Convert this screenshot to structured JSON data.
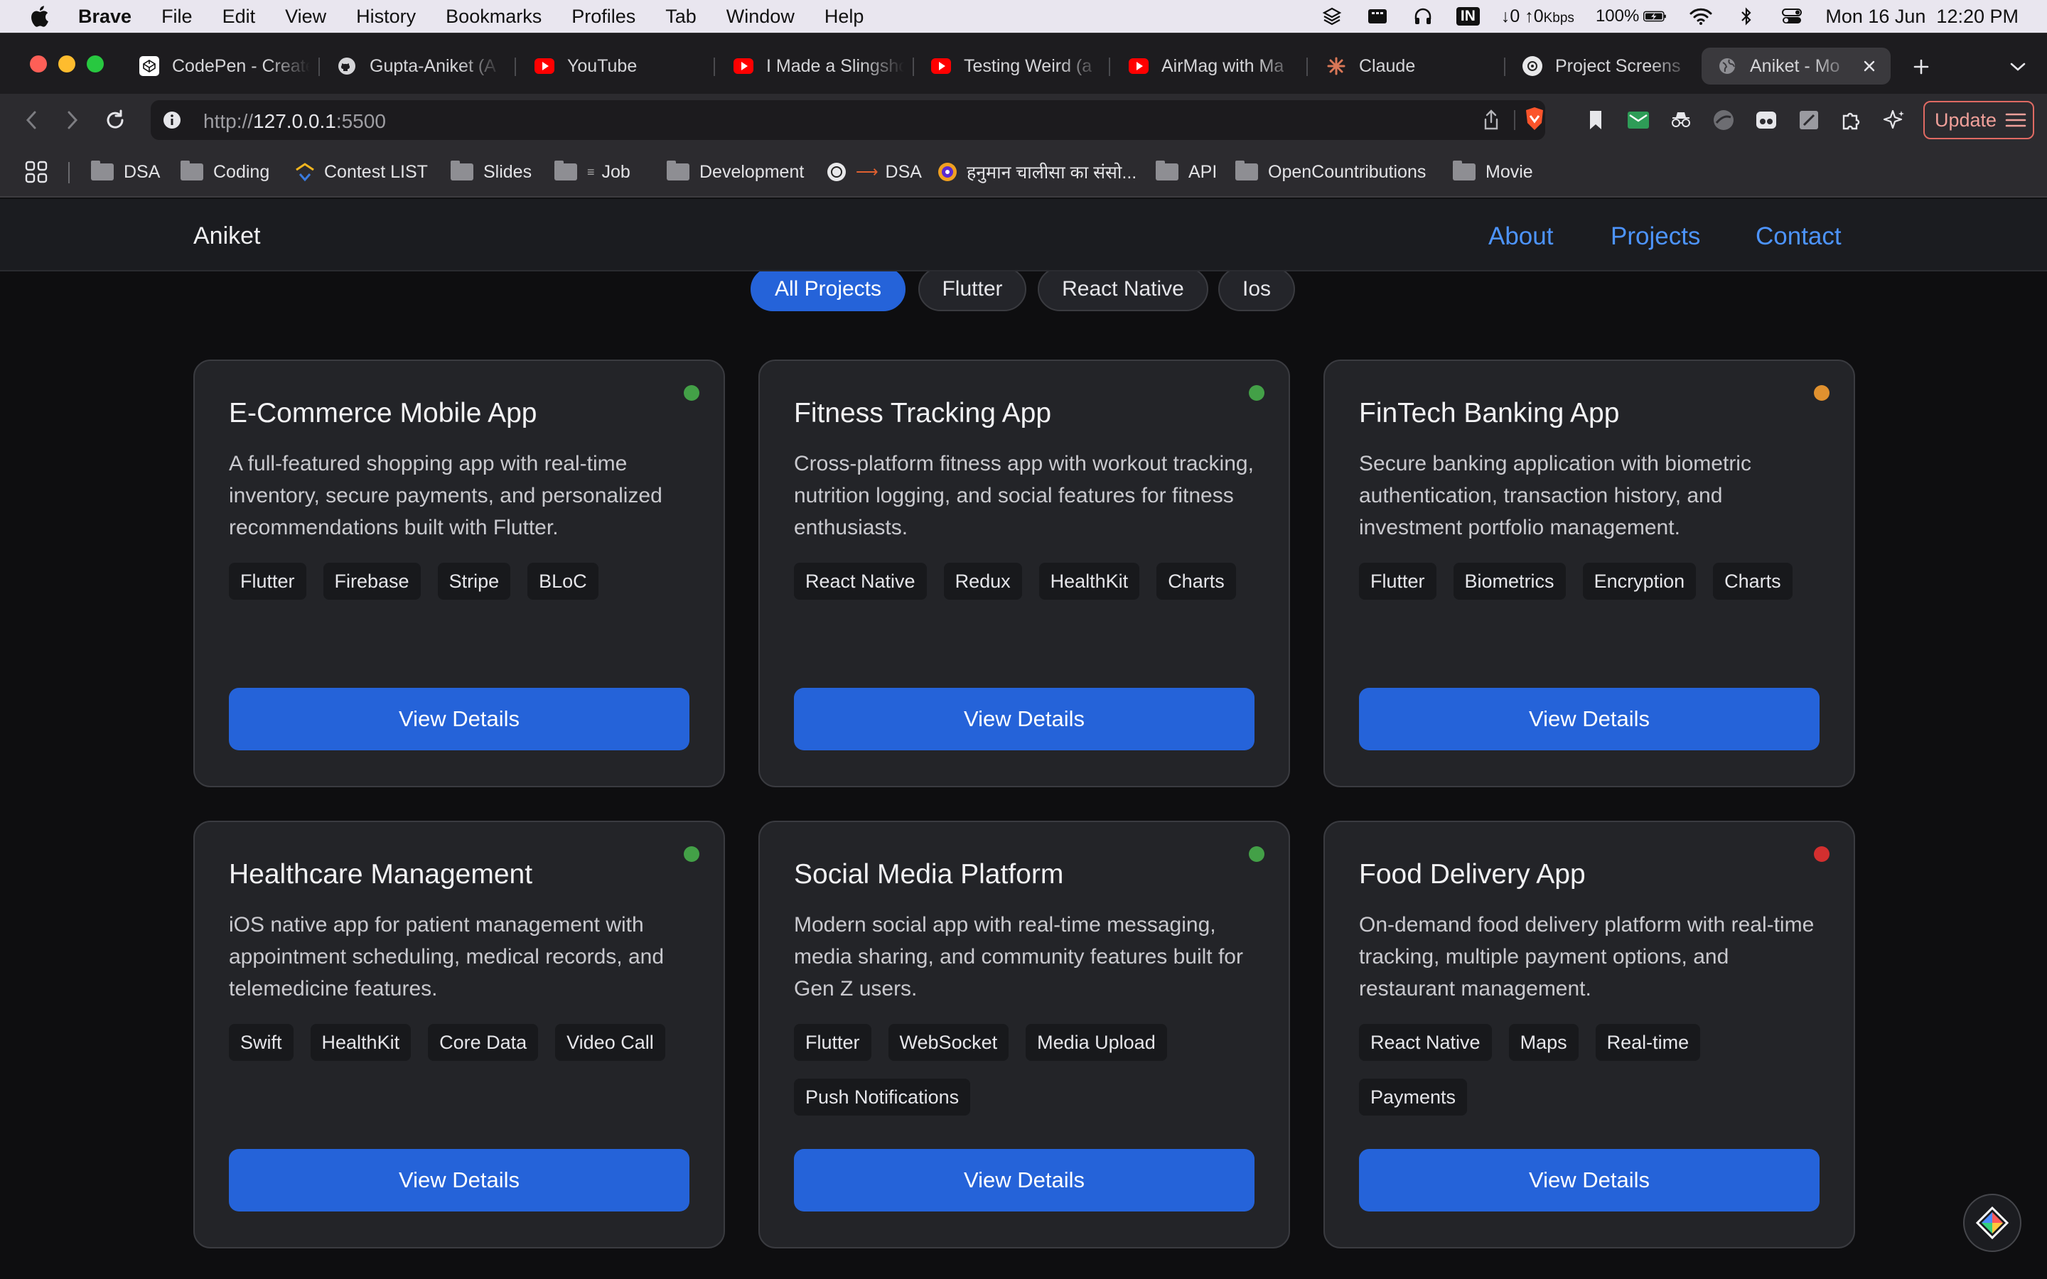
{
  "menubar": {
    "items": [
      "Brave",
      "File",
      "Edit",
      "View",
      "History",
      "Bookmarks",
      "Profiles",
      "Tab",
      "Window",
      "Help"
    ],
    "network": {
      "down": "↓0",
      "up": "↑0",
      "unit": "Kbps"
    },
    "input_source": "IN",
    "battery": "100%",
    "datetime": "Mon 16 Jun  12:20 PM"
  },
  "tabs": [
    {
      "label": "CodePen - Create"
    },
    {
      "label": "Gupta-Aniket (A"
    },
    {
      "label": "YouTube"
    },
    {
      "label": "I Made a Slingshot"
    },
    {
      "label": "Testing Weird (a"
    },
    {
      "label": "AirMag with Ma"
    },
    {
      "label": "Claude"
    },
    {
      "label": "Project Screens"
    },
    {
      "label": "Aniket - Mo"
    }
  ],
  "address": {
    "scheme": "http://",
    "host": "127.0.0.1",
    "port": ":5500"
  },
  "update_label": "Update",
  "bookmarks": [
    "DSA",
    "Coding",
    "Contest LIST",
    "Slides",
    "Job",
    "Development",
    "DSA",
    "हनुमान चालीसा का संसो...",
    "API",
    "OpenCountributions",
    "Movie"
  ],
  "site": {
    "brand": "Aniket",
    "nav": [
      "About",
      "Projects",
      "Contact"
    ],
    "filters": [
      "All Projects",
      "Flutter",
      "React Native",
      "Ios"
    ]
  },
  "projects": [
    {
      "title": "E-Commerce Mobile App",
      "description": "A full-featured shopping app with real-time inventory, secure payments, and personalized recommendations built with Flutter.",
      "tags": [
        "Flutter",
        "Firebase",
        "Stripe",
        "BLoC"
      ],
      "status_color": "#43a047",
      "button": "View Details"
    },
    {
      "title": "Fitness Tracking App",
      "description": "Cross-platform fitness app with workout tracking, nutrition logging, and social features for fitness enthusiasts.",
      "tags": [
        "React Native",
        "Redux",
        "HealthKit",
        "Charts"
      ],
      "status_color": "#43a047",
      "button": "View Details"
    },
    {
      "title": "FinTech Banking App",
      "description": "Secure banking application with biometric authentication, transaction history, and investment portfolio management.",
      "tags": [
        "Flutter",
        "Biometrics",
        "Encryption",
        "Charts"
      ],
      "status_color": "#e0912f",
      "button": "View Details"
    },
    {
      "title": "Healthcare Management",
      "description": "iOS native app for patient management with appointment scheduling, medical records, and telemedicine features.",
      "tags": [
        "Swift",
        "HealthKit",
        "Core Data",
        "Video Call"
      ],
      "status_color": "#43a047",
      "button": "View Details"
    },
    {
      "title": "Social Media Platform",
      "description": "Modern social app with real-time messaging, media sharing, and community features built for Gen Z users.",
      "tags": [
        "Flutter",
        "WebSocket",
        "Media Upload",
        "Push Notifications"
      ],
      "status_color": "#43a047",
      "button": "View Details"
    },
    {
      "title": "Food Delivery App",
      "description": "On-demand food delivery platform with real-time tracking, multiple payment options, and restaurant management.",
      "tags": [
        "React Native",
        "Maps",
        "Real-time",
        "Payments"
      ],
      "status_color": "#d32f2f",
      "button": "View Details"
    }
  ]
}
